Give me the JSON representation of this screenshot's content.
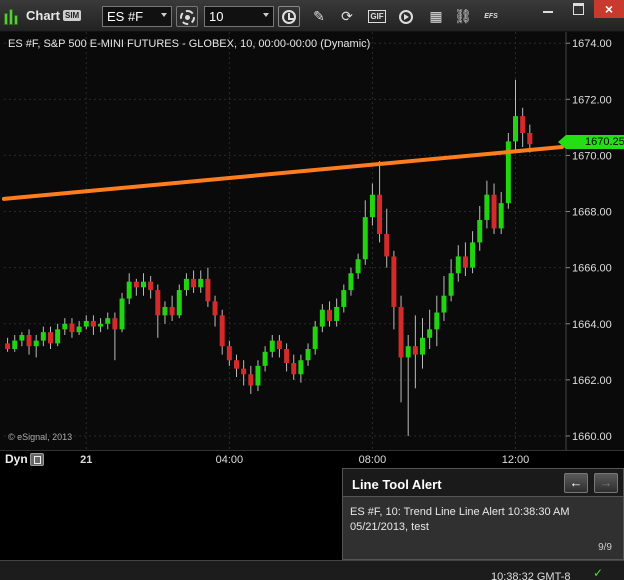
{
  "toolbar": {
    "title": "Chart",
    "mode_badge": "SIM",
    "symbol": "ES #F",
    "interval": "10",
    "icons": [
      "chart-app-icon",
      "settings-gear-icon",
      "clock-icon",
      "pencil-icon",
      "refresh-icon",
      "gif-icon",
      "play-icon",
      "grid-icon",
      "link-icon",
      "efs-icon"
    ],
    "gif_label": "GIF",
    "efs_label": "EFS",
    "close_label": "×"
  },
  "chart": {
    "header": "ES #F, S&P 500 E-MINI FUTURES - GLOBEX, 10, 00:00-00:00 (Dynamic)",
    "copyright": "© eSignal, 2013",
    "last_price_tag": "1670.25",
    "colors": {
      "up": "#22d312",
      "down": "#d42a2a",
      "trendline": "#ff7d1e",
      "tag": "#22e012",
      "grid": "#2a2a2a"
    }
  },
  "chart_data": {
    "type": "candlestick",
    "y_ticks": [
      "1674.00",
      "1672.00",
      "1670.00",
      "1668.00",
      "1666.00",
      "1664.00",
      "1662.00",
      "1660.00"
    ],
    "ylim": [
      1659.5,
      1674.4
    ],
    "x_ticks": [
      "21",
      "04:00",
      "08:00",
      "12:00"
    ],
    "x_tick_bars": [
      11,
      31,
      51,
      71
    ],
    "trendline": {
      "start": [
        -0.5,
        1668.45
      ],
      "end": [
        77.5,
        1670.3
      ],
      "color": "#ff7d1e"
    },
    "candles": [
      [
        1663.3,
        1663.1,
        1663.5,
        1663.0
      ],
      [
        1663.1,
        1663.4,
        1663.6,
        1663.0
      ],
      [
        1663.4,
        1663.6,
        1663.7,
        1663.2
      ],
      [
        1663.6,
        1663.2,
        1663.8,
        1662.9
      ],
      [
        1663.2,
        1663.4,
        1663.6,
        1662.8
      ],
      [
        1663.4,
        1663.7,
        1663.9,
        1663.2
      ],
      [
        1663.7,
        1663.3,
        1663.9,
        1663.1
      ],
      [
        1663.3,
        1663.8,
        1664.0,
        1663.2
      ],
      [
        1663.8,
        1664.0,
        1664.2,
        1663.6
      ],
      [
        1664.0,
        1663.7,
        1664.2,
        1663.5
      ],
      [
        1663.7,
        1663.9,
        1664.1,
        1663.6
      ],
      [
        1663.9,
        1664.1,
        1664.3,
        1663.8
      ],
      [
        1664.1,
        1663.9,
        1664.3,
        1663.6
      ],
      [
        1663.9,
        1664.0,
        1664.2,
        1663.7
      ],
      [
        1664.0,
        1664.2,
        1664.4,
        1663.8
      ],
      [
        1664.2,
        1663.8,
        1664.4,
        1662.7
      ],
      [
        1663.8,
        1664.9,
        1665.1,
        1663.7
      ],
      [
        1664.9,
        1665.5,
        1665.8,
        1664.7
      ],
      [
        1665.5,
        1665.3,
        1665.6,
        1665.0
      ],
      [
        1665.3,
        1665.5,
        1665.8,
        1665.0
      ],
      [
        1665.5,
        1665.2,
        1665.7,
        1664.9
      ],
      [
        1665.2,
        1664.3,
        1665.4,
        1663.5
      ],
      [
        1664.3,
        1664.6,
        1664.8,
        1664.0
      ],
      [
        1664.6,
        1664.3,
        1665.0,
        1664.1
      ],
      [
        1664.3,
        1665.2,
        1665.4,
        1664.2
      ],
      [
        1665.2,
        1665.6,
        1665.8,
        1665.0
      ],
      [
        1665.6,
        1665.3,
        1665.9,
        1665.1
      ],
      [
        1665.3,
        1665.6,
        1665.9,
        1665.1
      ],
      [
        1665.6,
        1664.8,
        1666.0,
        1664.6
      ],
      [
        1664.8,
        1664.3,
        1665.0,
        1663.9
      ],
      [
        1664.3,
        1663.2,
        1664.5,
        1662.9
      ],
      [
        1663.2,
        1662.7,
        1663.4,
        1662.5
      ],
      [
        1662.7,
        1662.4,
        1662.9,
        1662.1
      ],
      [
        1662.4,
        1662.2,
        1662.7,
        1661.8
      ],
      [
        1662.2,
        1661.8,
        1662.5,
        1661.5
      ],
      [
        1661.8,
        1662.5,
        1662.7,
        1661.6
      ],
      [
        1662.5,
        1663.0,
        1663.2,
        1662.3
      ],
      [
        1663.0,
        1663.4,
        1663.6,
        1662.8
      ],
      [
        1663.4,
        1663.1,
        1663.6,
        1662.8
      ],
      [
        1663.1,
        1662.6,
        1663.3,
        1662.3
      ],
      [
        1662.6,
        1662.2,
        1662.9,
        1662.0
      ],
      [
        1662.2,
        1662.7,
        1662.9,
        1661.9
      ],
      [
        1662.7,
        1663.1,
        1663.3,
        1662.5
      ],
      [
        1663.1,
        1663.9,
        1664.1,
        1662.9
      ],
      [
        1663.9,
        1664.5,
        1664.7,
        1663.7
      ],
      [
        1664.5,
        1664.1,
        1664.8,
        1663.9
      ],
      [
        1664.1,
        1664.6,
        1664.9,
        1663.9
      ],
      [
        1664.6,
        1665.2,
        1665.4,
        1664.4
      ],
      [
        1665.2,
        1665.8,
        1666.0,
        1665.0
      ],
      [
        1665.8,
        1666.3,
        1666.5,
        1665.6
      ],
      [
        1666.3,
        1667.8,
        1668.4,
        1666.1
      ],
      [
        1667.8,
        1668.6,
        1669.0,
        1667.5
      ],
      [
        1668.6,
        1667.2,
        1669.8,
        1666.9
      ],
      [
        1667.2,
        1666.4,
        1668.1,
        1666.0
      ],
      [
        1666.4,
        1664.6,
        1666.6,
        1663.8
      ],
      [
        1664.6,
        1662.8,
        1665.0,
        1661.2
      ],
      [
        1662.8,
        1663.2,
        1663.6,
        1660.0
      ],
      [
        1663.2,
        1662.9,
        1664.3,
        1661.7
      ],
      [
        1662.9,
        1663.5,
        1664.2,
        1662.4
      ],
      [
        1663.5,
        1663.8,
        1664.5,
        1663.1
      ],
      [
        1663.8,
        1664.4,
        1665.0,
        1663.2
      ],
      [
        1664.4,
        1665.0,
        1665.7,
        1664.1
      ],
      [
        1665.0,
        1665.8,
        1666.3,
        1664.8
      ],
      [
        1665.8,
        1666.4,
        1666.8,
        1665.5
      ],
      [
        1666.4,
        1666.0,
        1666.9,
        1665.7
      ],
      [
        1666.0,
        1666.9,
        1667.3,
        1665.8
      ],
      [
        1666.9,
        1667.7,
        1668.2,
        1666.6
      ],
      [
        1667.7,
        1668.6,
        1669.1,
        1667.4
      ],
      [
        1668.6,
        1667.4,
        1669.0,
        1667.2
      ],
      [
        1667.4,
        1668.3,
        1668.7,
        1667.2
      ],
      [
        1668.3,
        1670.5,
        1670.8,
        1668.1
      ],
      [
        1670.5,
        1671.4,
        1672.7,
        1670.2
      ],
      [
        1671.4,
        1670.8,
        1671.7,
        1670.3
      ],
      [
        1670.8,
        1670.4,
        1671.1,
        1670.1
      ]
    ]
  },
  "xaxis": {
    "mode_label": "Dyn"
  },
  "alert_panel": {
    "title": "Line Tool Alert",
    "prev_label": "←",
    "next_label": "→",
    "message_line1": "ES #F, 10: Trend Line Line Alert 10:38:30 AM",
    "message_line2": "05/21/2013, test",
    "count": "9/9"
  },
  "status_bar": {
    "time": "10:38:32 GMT-8"
  }
}
